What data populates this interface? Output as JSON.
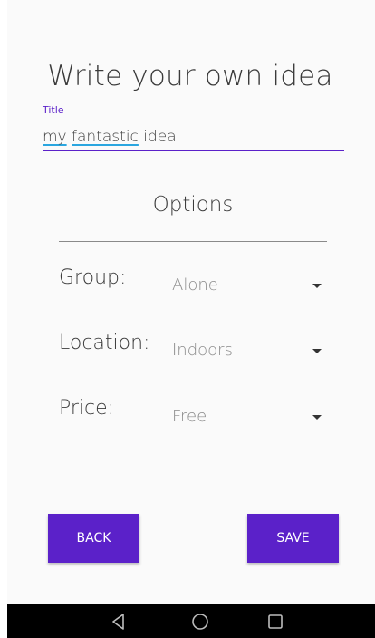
{
  "header": {
    "title": "Write your own idea"
  },
  "title_field": {
    "label": "Title",
    "value_words": [
      "my",
      "fantastic",
      "idea"
    ]
  },
  "options": {
    "heading": "Options",
    "rows": [
      {
        "label": "Group:",
        "value": "Alone"
      },
      {
        "label": "Location:",
        "value": "Indoors"
      },
      {
        "label": "Price:",
        "value": "Free"
      }
    ]
  },
  "actions": {
    "back_label": "BACK",
    "save_label": "SAVE"
  },
  "colors": {
    "accent": "#5b21c9",
    "spellcheck": "#2aa6e0",
    "navbar": "#000000"
  },
  "navbar": {
    "buttons": [
      "back-icon",
      "home-icon",
      "recents-icon"
    ]
  }
}
